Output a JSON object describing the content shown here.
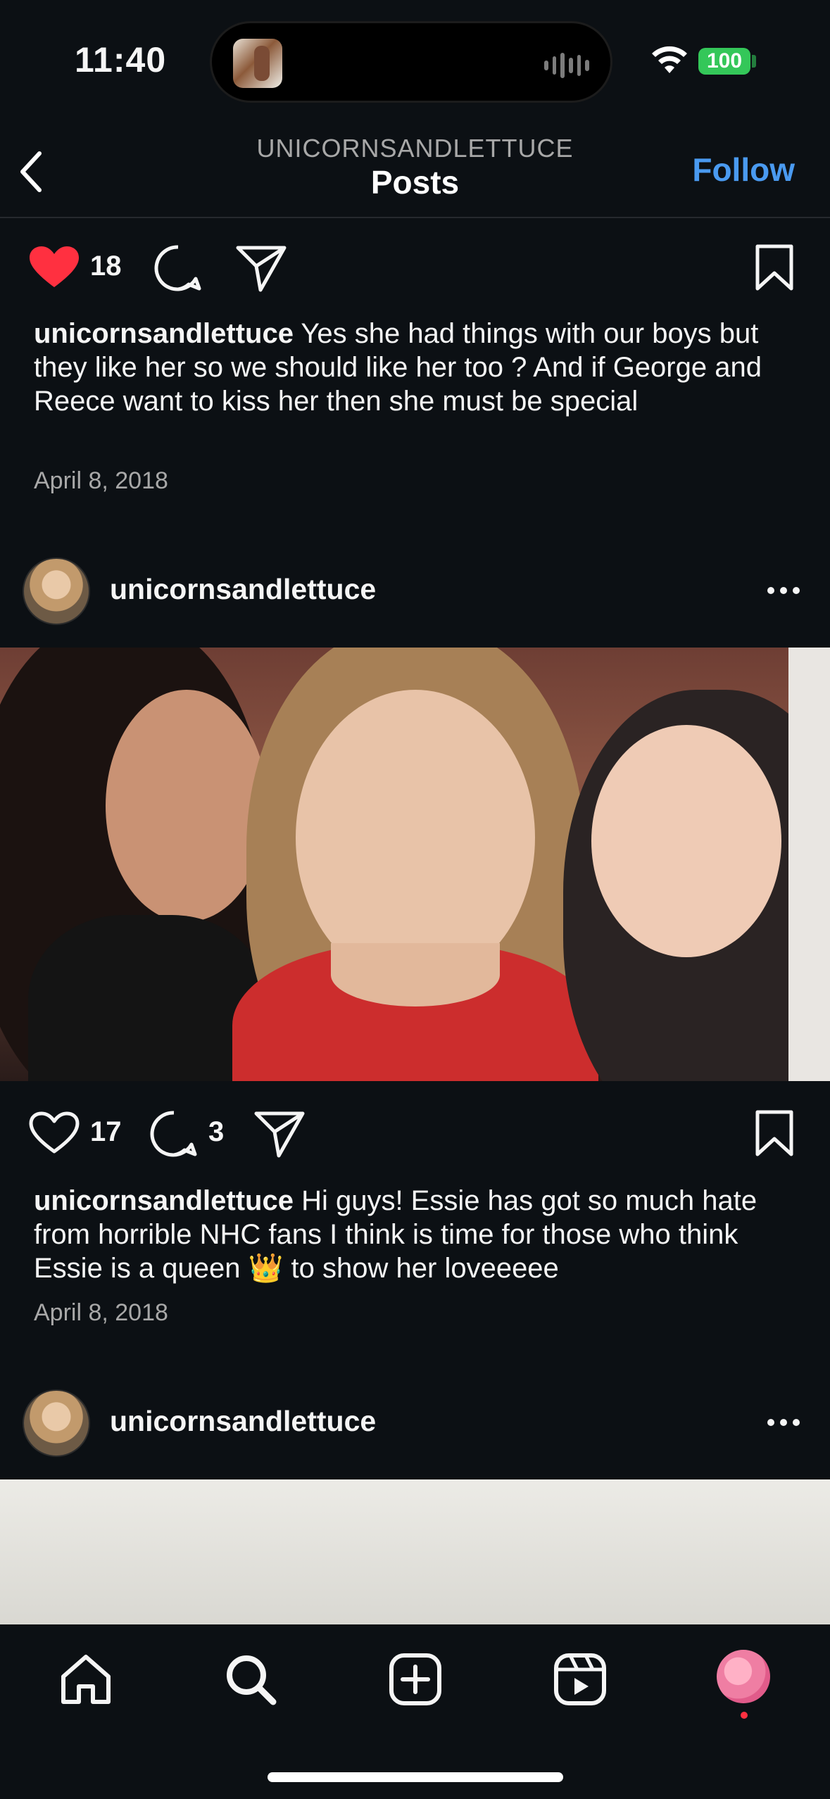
{
  "status_bar": {
    "time": "11:40",
    "battery": "100"
  },
  "header": {
    "subtitle": "UNICORNSANDLETTUCE",
    "title": "Posts",
    "follow_label": "Follow"
  },
  "post1": {
    "likes": "18",
    "username": "unicornsandlettuce",
    "caption": "Yes she had things with our boys but they like her so we should like her too ? And if George and Reece want to kiss her then she must be special",
    "date": "April 8, 2018"
  },
  "post2": {
    "username": "unicornsandlettuce",
    "likes": "17",
    "comments": "3",
    "caption_user": "unicornsandlettuce",
    "caption": "Hi guys! Essie has got so much hate from horrible NHC fans I think is time for those who think Essie is a queen 👑 to show her loveeeee",
    "date": "April 8, 2018"
  },
  "post3": {
    "username": "unicornsandlettuce"
  },
  "colors": {
    "background": "#0c1014",
    "accent": "#4a9af0",
    "like_red": "#ff3040",
    "battery_green": "#34c759"
  },
  "icons": [
    "back-icon",
    "heart-filled-icon",
    "heart-outline-icon",
    "comment-icon",
    "share-icon",
    "bookmark-icon",
    "more-icon",
    "home-icon",
    "search-icon",
    "create-icon",
    "reels-icon"
  ]
}
